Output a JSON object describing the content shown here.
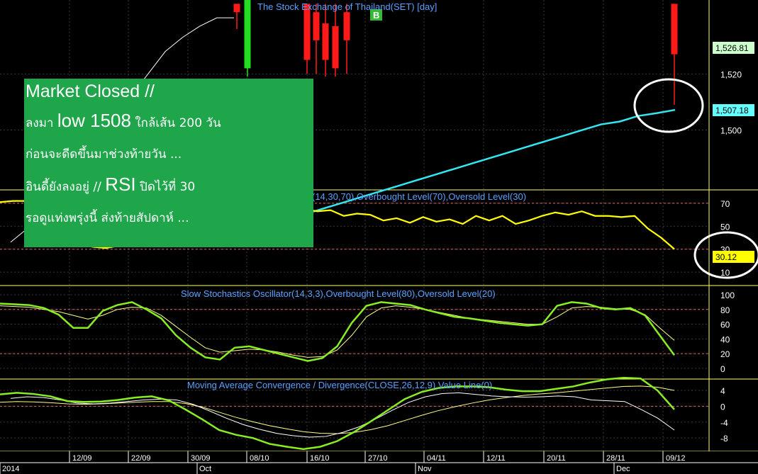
{
  "chart_data": [
    {
      "type": "candlestick+line",
      "title": "The Stock Exchange of Thailand(SET) [day]",
      "y_ticks": [
        "1,520",
        "1,500"
      ],
      "last_price_label": "1,526.81",
      "ma_label": "1,507.18",
      "signal_marker": "B",
      "series": [
        {
          "values": [
            1460,
            1465,
            1472,
            1480,
            1488,
            1495,
            1503,
            1512,
            1520,
            1528,
            1533,
            1537,
            1540,
            1540
          ]
        },
        {
          "values": [
            1470,
            1472,
            1474,
            1476,
            1478,
            1480,
            1482,
            1484,
            1486,
            1488,
            1490,
            1492,
            1494,
            1496,
            1498,
            1500,
            1502,
            1503,
            1505,
            1506,
            1507.18
          ]
        }
      ]
    },
    {
      "type": "line",
      "title": "(14,30,70),Overbought Level(70),Oversold Level(30)",
      "y_ticks": [
        "70",
        "50",
        "30",
        "10"
      ],
      "levels": [
        70,
        30
      ],
      "last_value_label": "30.12",
      "series": [
        {
          "values": [
            71,
            72,
            72,
            68,
            55,
            45,
            35,
            32,
            31,
            33,
            33,
            34,
            33,
            34,
            33,
            34,
            33,
            33,
            38,
            45,
            52,
            55,
            56,
            65,
            63,
            64,
            59,
            61,
            60,
            55,
            57,
            53,
            58,
            54,
            56,
            52,
            59,
            55,
            59,
            52,
            55,
            59,
            62,
            60,
            63,
            59,
            59,
            58,
            59,
            48,
            40,
            30.12
          ]
        }
      ]
    },
    {
      "type": "line",
      "title": "Slow Stochastics Oscillator(14,3,3),Overbought Level(80),Oversold Level(20)",
      "y_ticks": [
        "100",
        "80",
        "60",
        "40",
        "20",
        "0"
      ],
      "levels": [
        80,
        20
      ],
      "series": [
        {
          "values": [
            88,
            87,
            86,
            82,
            73,
            55,
            55,
            78,
            86,
            90,
            80,
            68,
            45,
            28,
            15,
            12,
            28,
            30,
            25,
            20,
            15,
            10,
            14,
            30,
            62,
            85,
            90,
            88,
            86,
            80,
            75,
            70,
            68,
            65,
            62,
            60,
            58,
            60,
            85,
            90,
            88,
            82,
            80,
            82,
            72,
            45,
            18
          ]
        },
        {
          "values": [
            85,
            84,
            83,
            80,
            77,
            72,
            67,
            72,
            80,
            83,
            82,
            72,
            57,
            42,
            28,
            22,
            24,
            26,
            25,
            22,
            18,
            15,
            16,
            25,
            45,
            70,
            82,
            85,
            83,
            80,
            76,
            72,
            68,
            66,
            64,
            62,
            60,
            60,
            70,
            82,
            84,
            83,
            81,
            80,
            73,
            55,
            38
          ]
        }
      ]
    },
    {
      "type": "line",
      "title": "Moving Average Convergence / Divergence(CLOSE,26,12,9),Value Line(0)",
      "y_ticks": [
        "4",
        "0",
        "-4",
        "-8"
      ],
      "levels": [
        0
      ],
      "series": [
        {
          "values": [
            3.0,
            3.4,
            3.1,
            2.5,
            1.3,
            1.1,
            1.2,
            1.6,
            2.2,
            2.5,
            1.5,
            -0.8,
            -3.3,
            -6.0,
            -7.2,
            -8.0,
            -9.5,
            -10.2,
            -10.8,
            -10.2,
            -8.8,
            -6.5,
            -3.8,
            -1.0,
            1.8,
            3.6,
            4.6,
            5.0,
            5.0,
            4.8,
            4.2,
            3.8,
            3.8,
            4.4,
            5.0,
            6.0,
            6.8,
            7.2,
            7.0,
            4.0,
            -0.8
          ]
        },
        {
          "values": [
            2.0,
            2.4,
            2.2,
            1.6,
            0.8,
            0.6,
            0.8,
            1.2,
            1.6,
            1.8,
            1.6,
            0.5,
            -1.2,
            -3.0,
            -4.6,
            -5.8,
            -6.8,
            -7.4,
            -7.8,
            -7.6,
            -6.6,
            -5.2,
            -3.2,
            -1.0,
            1.0,
            2.4,
            3.2,
            3.4,
            3.0,
            2.6,
            2.4,
            2.3,
            2.4,
            2.6,
            2.4,
            1.6,
            1.4,
            1.2,
            -0.8,
            -3.0,
            -6.0
          ]
        },
        {
          "values": [
            1.0,
            1.2,
            1.1,
            0.9,
            0.6,
            0.5,
            0.6,
            0.8,
            1.0,
            1.2,
            1.2,
            0.7,
            -0.2,
            -1.5,
            -2.8,
            -3.9,
            -4.9,
            -5.7,
            -6.4,
            -6.8,
            -6.9,
            -6.6,
            -5.9,
            -4.9,
            -3.6,
            -2.3,
            -1.1,
            -0.1,
            0.8,
            1.6,
            2.2,
            2.7,
            3.1,
            3.4,
            3.8,
            4.2,
            4.6,
            5.0,
            5.1,
            4.8,
            4.0
          ]
        }
      ]
    }
  ],
  "x_axis": {
    "date_labels": [
      "12/09",
      "22/09",
      "30/09",
      "08/10",
      "16/10",
      "27/10",
      "04/11",
      "12/11",
      "20/11",
      "28/11",
      "09/12"
    ],
    "period_labels": [
      "2014",
      "Oct",
      "Nov",
      "Dec"
    ]
  },
  "annotation": {
    "line1": "Market Closed //",
    "line2_a": "ลงมา ",
    "line2_big": "low 1508",
    "line2_b": " ใกล้เส้น 200 วัน",
    "line3": "ก่อนจะดีดขึ้นมาช่วงท้ายวัน ...",
    "line4_a": "อินดี้ยังลงอยู่ // ",
    "line4_big": "RSI",
    "line4_b": " ปิดไว้ที่ 30",
    "line5": "รอดูแท่งพรุ่งนี้ ส่งท้ายสัปดาห์ ..."
  },
  "colors": {
    "background": "#000000",
    "grid": "#3a3a3a",
    "panel_border": "#ffff66",
    "ma_line": "#33e6f2",
    "rsi_line": "#ffff00",
    "stoch_k": "#88ee22",
    "stoch_d": "#ffff88",
    "macd_line": "#88ee22",
    "macd_signal": "#ffff88",
    "macd_value": "#ffffff",
    "level_line": "#e06666",
    "label_text": "#5aa0ff",
    "axis_text": "#ffffff",
    "candle_down": "#ff1a1a",
    "candle_up": "#22dd22",
    "price_box": "#ccffcc",
    "ma_box": "#66ffff",
    "rsi_box": "#ffff00",
    "annotation_bg": "#1fa54a",
    "circle": "#ffffff"
  }
}
